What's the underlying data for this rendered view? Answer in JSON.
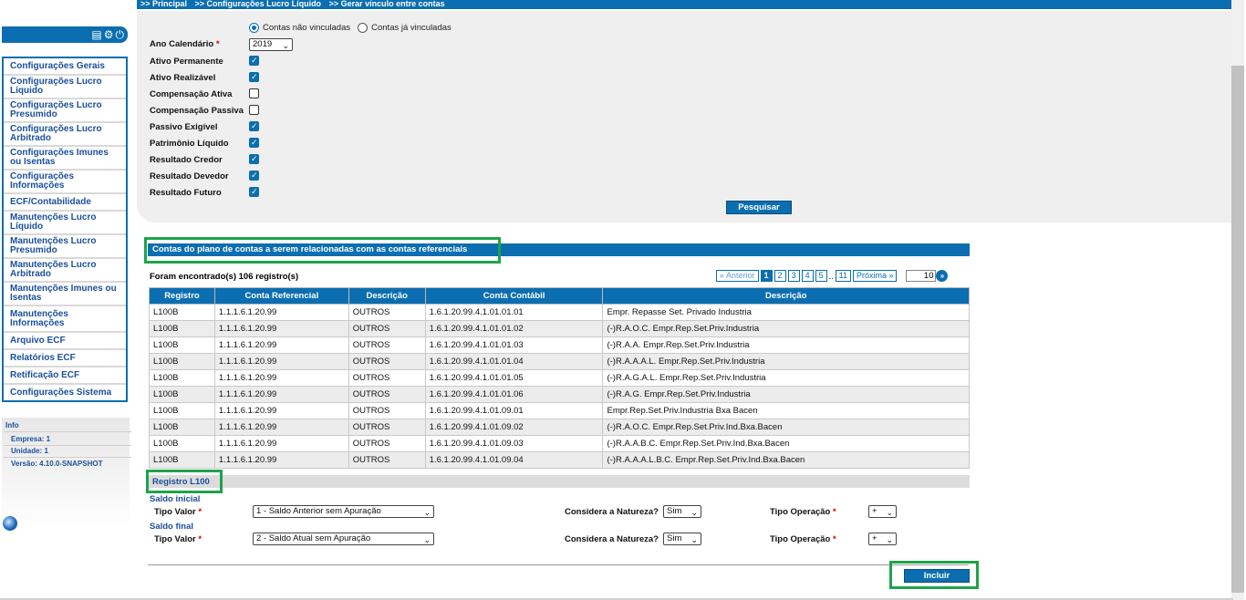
{
  "breadcrumb": [
    ">> Principal",
    ">> Configurações Lucro Líquido",
    ">> Gerar vínculo entre contas"
  ],
  "sidebar": {
    "header_icons": [
      "report-icon",
      "gear-icon",
      "power-icon"
    ],
    "items": [
      {
        "label": "Configurações Gerais"
      },
      {
        "label": "Configurações Lucro Líquido"
      },
      {
        "label": "Configurações Lucro Presumido"
      },
      {
        "label": "Configurações Lucro Arbitrado"
      },
      {
        "label": "Configurações Imunes ou Isentas"
      },
      {
        "label": "Configurações Informações"
      },
      {
        "label": "ECF/Contabilidade"
      },
      {
        "label": "Manutenções Lucro Líquido"
      },
      {
        "label": "Manutenções Lucro Presumido"
      },
      {
        "label": "Manutenções Lucro Arbitrado"
      },
      {
        "label": "Manutenções Imunes ou Isentas"
      },
      {
        "label": "Manutenções Informações"
      },
      {
        "label": "Arquivo ECF"
      },
      {
        "label": "Relatórios ECF"
      },
      {
        "label": "Retificação ECF"
      },
      {
        "label": "Configurações Sistema"
      }
    ],
    "info": {
      "title": "Info",
      "empresa": "Empresa: 1",
      "unidade": "Unidade: 1",
      "versao": "Versão: 4.10.0-SNAPSHOT"
    }
  },
  "filter": {
    "radio_options": [
      {
        "label": "Contas não vinculadas",
        "selected": true
      },
      {
        "label": "Contas já vinculadas",
        "selected": false
      }
    ],
    "ano_label": "Ano Calendário",
    "ano_value": "2019",
    "required_mark": "*",
    "checkboxes": [
      {
        "label": "Ativo Permanente",
        "checked": true
      },
      {
        "label": "Ativo Realizável",
        "checked": true
      },
      {
        "label": "Compensação Ativa",
        "checked": false
      },
      {
        "label": "Compensação Passiva",
        "checked": false
      },
      {
        "label": "Passivo Exigível",
        "checked": true
      },
      {
        "label": "Patrimônio Líquido",
        "checked": true
      },
      {
        "label": "Resultado Credor",
        "checked": true
      },
      {
        "label": "Resultado Devedor",
        "checked": true
      },
      {
        "label": "Resultado Futuro",
        "checked": true
      }
    ],
    "search_button": "Pesquisar"
  },
  "results": {
    "section_title": "Contas do plano de contas a serem relacionadas com as contas referenciais",
    "found_text": "Foram encontrado(s) 106 registro(s)",
    "pager": {
      "prev": "« Anterior",
      "pages": [
        "1",
        "2",
        "3",
        "4",
        "5"
      ],
      "ellipsis": "..",
      "last": "11",
      "next": "Próxima »",
      "page_size": "10",
      "go": "»"
    },
    "columns": [
      "Registro",
      "Conta Referencial",
      "Descrição",
      "Conta Contábil",
      "Descrição"
    ],
    "rows": [
      [
        "L100B",
        "1.1.1.6.1.20.99",
        "OUTROS",
        "1.6.1.20.99.4.1.01.01.01",
        "Empr. Repasse Set. Privado Industria"
      ],
      [
        "L100B",
        "1.1.1.6.1.20.99",
        "OUTROS",
        "1.6.1.20.99.4.1.01.01.02",
        "(-)R.A.O.C. Empr.Rep.Set.Priv.Industria"
      ],
      [
        "L100B",
        "1.1.1.6.1.20.99",
        "OUTROS",
        "1.6.1.20.99.4.1.01.01.03",
        "(-)R.A.A. Empr.Rep.Set.Priv.Industria"
      ],
      [
        "L100B",
        "1.1.1.6.1.20.99",
        "OUTROS",
        "1.6.1.20.99.4.1.01.01.04",
        "(-)R.A.A.A.L. Empr.Rep.Set.Priv.Industria"
      ],
      [
        "L100B",
        "1.1.1.6.1.20.99",
        "OUTROS",
        "1.6.1.20.99.4.1.01.01.05",
        "(-)R.A.G.A.L. Empr.Rep.Set.Priv.Industria"
      ],
      [
        "L100B",
        "1.1.1.6.1.20.99",
        "OUTROS",
        "1.6.1.20.99.4.1.01.01.06",
        "(-)R.A.G. Empr.Rep.Set.Priv.Industria"
      ],
      [
        "L100B",
        "1.1.1.6.1.20.99",
        "OUTROS",
        "1.6.1.20.99.4.1.01.09.01",
        "Empr.Rep.Set.Priv.Industria Bxa Bacen"
      ],
      [
        "L100B",
        "1.1.1.6.1.20.99",
        "OUTROS",
        "1.6.1.20.99.4.1.01.09.02",
        "(-)R.A.O.C. Empr.Rep.Set.Priv.Ind.Bxa.Bacen"
      ],
      [
        "L100B",
        "1.1.1.6.1.20.99",
        "OUTROS",
        "1.6.1.20.99.4.1.01.09.03",
        "(-)R.A.A.B.C. Empr.Rep.Set.Priv.Ind.Bxa.Bacen"
      ],
      [
        "L100B",
        "1.1.1.6.1.20.99",
        "OUTROS",
        "1.6.1.20.99.4.1.01.09.04",
        "(-)R.A.A.A.L.B.C. Empr.Rep.Set.Priv.Ind.Bxa.Bacen"
      ]
    ]
  },
  "registro": {
    "title": "Registro L100",
    "saldo_inicial": "Saldo inicial",
    "saldo_final": "Saldo final",
    "tipo_valor_label": "Tipo Valor",
    "tipo_valor_inicial": "1 - Saldo Anterior sem Apuração",
    "tipo_valor_final": "2 - Saldo Atual sem Apuração",
    "natureza_label": "Considera a Natureza?",
    "natureza_inicial": "Sim",
    "natureza_final": "Sim",
    "operacao_label": "Tipo Operação",
    "operacao_inicial": "+",
    "operacao_final": "+",
    "required_mark": "*",
    "include_button": "Incluir"
  },
  "colors": {
    "primary": "#0b6eb0",
    "highlight": "#1fa34a",
    "panel": "#efefef"
  }
}
